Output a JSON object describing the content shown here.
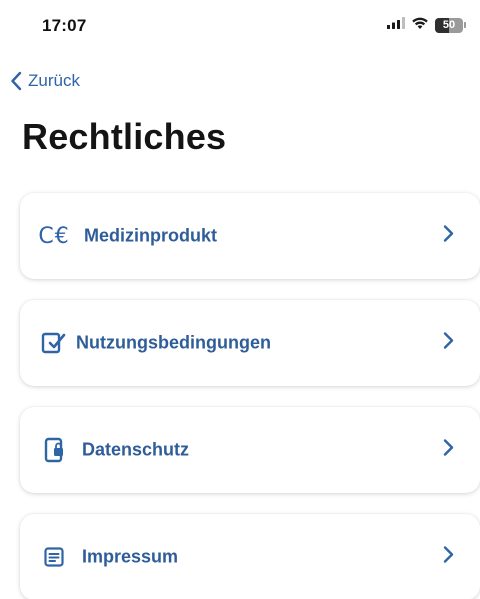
{
  "status_bar": {
    "time": "17:07",
    "battery_level": "50",
    "icons": [
      "signal-icon",
      "wifi-icon",
      "battery-icon"
    ]
  },
  "nav": {
    "back_label": "Zurück"
  },
  "page": {
    "title": "Rechtliches"
  },
  "items": [
    {
      "label": "Medizinprodukt",
      "icon": "ce-mark-icon",
      "icon_text": "C€"
    },
    {
      "label": "Nutzungsbedingungen",
      "icon": "document-check-icon"
    },
    {
      "label": "Datenschutz",
      "icon": "phone-lock-icon"
    },
    {
      "label": "Impressum",
      "icon": "text-document-icon"
    }
  ],
  "colors": {
    "accent": "#2f64a6",
    "title": "#141414",
    "background": "#ffffff"
  }
}
